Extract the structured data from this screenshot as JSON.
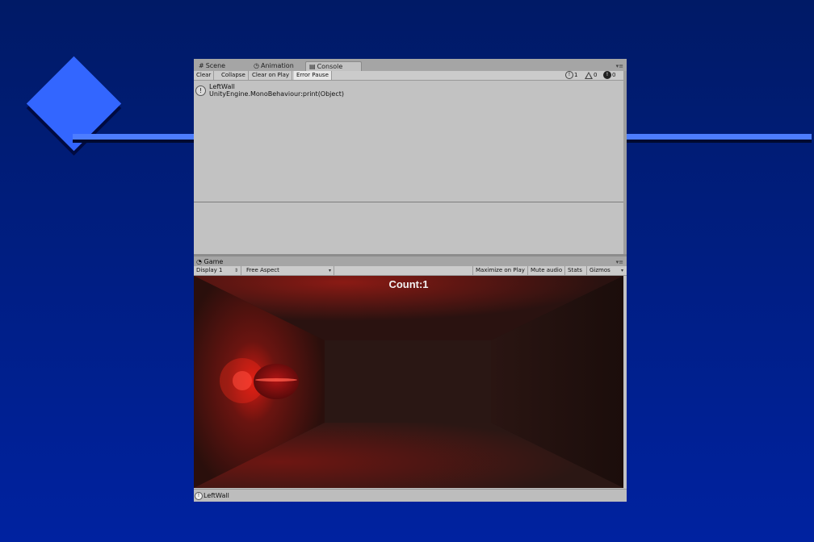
{
  "tabs": [
    {
      "label": "Scene",
      "icon": "grid-icon"
    },
    {
      "label": "Animation",
      "icon": "clock-icon"
    },
    {
      "label": "Console",
      "icon": "console-icon"
    }
  ],
  "console_toolbar": {
    "clear": "Clear",
    "collapse": "Collapse",
    "clear_on_play": "Clear on Play",
    "error_pause": "Error Pause",
    "info_count": "1",
    "warning_count": "0",
    "error_count": "0"
  },
  "log_entries": [
    {
      "message": "LeftWall",
      "stack": "UnityEngine.MonoBehaviour:print(Object)",
      "icon": "info-icon"
    }
  ],
  "game": {
    "tab_label": "Game",
    "display": "Display 1",
    "aspect": "Free Aspect",
    "maximize_on_play": "Maximize on Play",
    "mute_audio": "Mute audio",
    "stats": "Stats",
    "gizmos": "Gizmos",
    "hud_count": "Count:1"
  },
  "status": {
    "message": "LeftWall"
  },
  "colors": {
    "background": "#0022a0",
    "accent": "#3366ff",
    "glow": "#ff2020"
  }
}
